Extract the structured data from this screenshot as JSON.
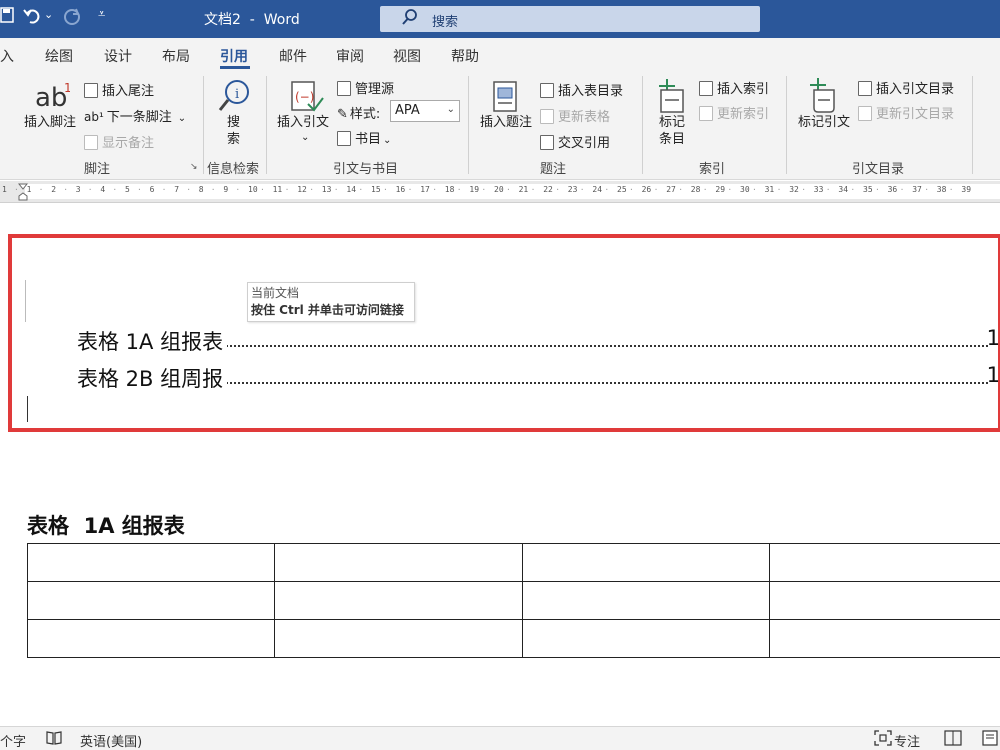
{
  "titlebar": {
    "save_icon": "save-icon",
    "undo_icon": "undo-icon",
    "redo_icon": "redo-icon",
    "qat_icon": "customize-quick-access-icon",
    "title": "文档2  -  Word",
    "search_placeholder": "搜索"
  },
  "tabs": [
    "插入",
    "绘图",
    "设计",
    "布局",
    "引用",
    "邮件",
    "审阅",
    "视图",
    "帮助"
  ],
  "tab_first_visible": "入",
  "active_tab": "引用",
  "ribbon": {
    "footnotes": {
      "label": "脚注",
      "insert_footnote": "插入脚注",
      "insert_endnote": "插入尾注",
      "next_footnote": "下一条脚注",
      "show_notes": "显示备注"
    },
    "research": {
      "label": "信息检索",
      "search_line1": "搜",
      "search_line2": "索"
    },
    "citations": {
      "label": "引文与书目",
      "insert_citation": "插入引文",
      "manage_sources": "管理源",
      "style_label": "样式:",
      "style_value": "APA",
      "bibliography": "书目"
    },
    "captions": {
      "label": "题注",
      "insert_caption": "插入题注",
      "insert_table_of_figures": "插入表目录",
      "update_table": "更新表格",
      "cross_reference": "交叉引用"
    },
    "index": {
      "label": "索引",
      "mark_entry_line1": "标记",
      "mark_entry_line2": "条目",
      "insert_index": "插入索引",
      "update_index": "更新索引"
    },
    "table_of_authorities": {
      "label": "引文目录",
      "mark_citation": "标记引文",
      "insert_table": "插入引文目录",
      "update_table": "更新引文目录"
    }
  },
  "ruler": {
    "numbers": [
      "1",
      "1",
      "2",
      "3",
      "4",
      "5",
      "6",
      "7",
      "8",
      "9",
      "10",
      "11",
      "12",
      "13",
      "14",
      "15",
      "16",
      "17",
      "18",
      "19",
      "20",
      "21",
      "22",
      "23",
      "24",
      "25",
      "26",
      "27",
      "28",
      "29",
      "30",
      "31",
      "32",
      "33",
      "34",
      "35",
      "36",
      "37",
      "38",
      "39"
    ]
  },
  "document": {
    "tooltip_line1": "当前文档",
    "tooltip_line2": "按住 Ctrl 并单击可访问链接",
    "toc": [
      {
        "text": "表格  1A 组报表",
        "page": "1"
      },
      {
        "text": "表格  2B 组周报",
        "page": "1"
      }
    ],
    "caption": "表格  1A 组报表",
    "table": {
      "rows": 3,
      "cols": 4
    }
  },
  "statusbar": {
    "word_count": "个字",
    "proofing_icon": "book-check-icon",
    "language": "英语(美国)",
    "focus": "专注"
  },
  "colors": {
    "titlebar": "#2b579a",
    "highlight_border": "#e03a3a",
    "ribbon_bg": "#f3f3f3"
  }
}
